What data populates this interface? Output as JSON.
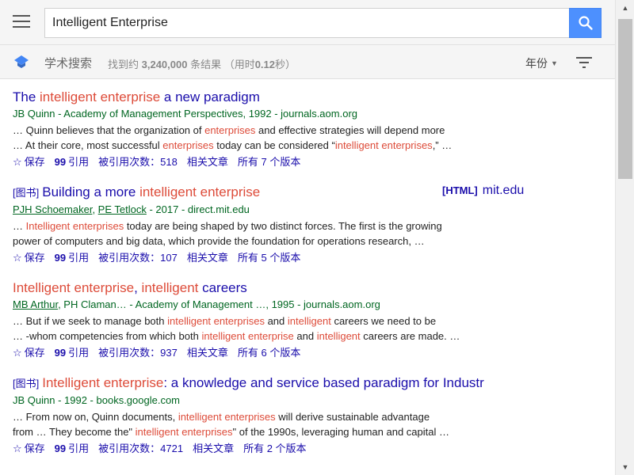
{
  "search": {
    "value": "Intelligent Enterprise"
  },
  "header": {
    "scholar_label": "学术搜索",
    "results_prefix": "找到约 ",
    "results_count": "3,240,000",
    "results_suffix": " 条结果 （用时",
    "time": "0.12",
    "time_suffix": "秒）",
    "year_label": "年份"
  },
  "results": [
    {
      "title_parts": [
        {
          "text": "The ",
          "hl": false
        },
        {
          "text": "intelligent enterprise",
          "hl": true
        },
        {
          "text": " a new paradigm",
          "hl": false
        }
      ],
      "tag": "",
      "authors_text": "JB Quinn - Academy of Management Perspectives, 1992 - journals.aom.org",
      "snippet_lines": [
        [
          {
            "text": "… Quinn believes that the organization of ",
            "hl": false
          },
          {
            "text": "enterprises",
            "hl": true
          },
          {
            "text": " and effective strategies will depend more",
            "hl": false
          }
        ],
        [
          {
            "text": "… At their core, most successful ",
            "hl": false
          },
          {
            "text": "enterprises",
            "hl": true
          },
          {
            "text": " today can be considered “",
            "hl": false
          },
          {
            "text": "intelligent enterprises",
            "hl": true
          },
          {
            "text": ",” …",
            "hl": false
          }
        ]
      ],
      "save": "保存",
      "cite": "引用",
      "cited_by": "被引用次数：518",
      "related": "相关文章",
      "versions": "所有 7 个版本"
    },
    {
      "tag": "[图书]",
      "title_parts": [
        {
          "text": "Building a more ",
          "hl": false
        },
        {
          "text": "intelligent enterprise",
          "hl": true
        }
      ],
      "side_tag": "[HTML]",
      "side_link": "mit.edu",
      "authors_links": [
        "PJH Schoemaker",
        "PE Tetlock"
      ],
      "authors_rest": " - 2017 - direct.mit.edu",
      "snippet_lines": [
        [
          {
            "text": "… ",
            "hl": false
          },
          {
            "text": "Intelligent enterprises",
            "hl": true
          },
          {
            "text": " today are being shaped by two distinct forces. The first is the growing",
            "hl": false
          }
        ],
        [
          {
            "text": "power of computers and big data, which provide the foundation for operations research, …",
            "hl": false
          }
        ]
      ],
      "save": "保存",
      "cite": "引用",
      "cited_by": "被引用次数：107",
      "related": "相关文章",
      "versions": "所有 5 个版本"
    },
    {
      "tag": "",
      "title_parts": [
        {
          "text": "Intelligent enterprise",
          "hl": true
        },
        {
          "text": ", ",
          "hl": false
        },
        {
          "text": "intelligent",
          "hl": true
        },
        {
          "text": " careers",
          "hl": false
        }
      ],
      "authors_links": [
        "MB Arthur"
      ],
      "authors_rest": ", PH Claman… - Academy of Management …, 1995 - journals.aom.org",
      "snippet_lines": [
        [
          {
            "text": "… But if we seek to manage both ",
            "hl": false
          },
          {
            "text": "intelligent enterprises",
            "hl": true
          },
          {
            "text": " and ",
            "hl": false
          },
          {
            "text": "intelligent",
            "hl": true
          },
          {
            "text": " careers we need to be",
            "hl": false
          }
        ],
        [
          {
            "text": "… -whom competencies from which both ",
            "hl": false
          },
          {
            "text": "intelligent enterprise",
            "hl": true
          },
          {
            "text": " and ",
            "hl": false
          },
          {
            "text": "intelligent",
            "hl": true
          },
          {
            "text": " careers are made. …",
            "hl": false
          }
        ]
      ],
      "save": "保存",
      "cite": "引用",
      "cited_by": "被引用次数：937",
      "related": "相关文章",
      "versions": "所有 6 个版本"
    },
    {
      "tag": "[图书]",
      "title_parts": [
        {
          "text": "Intelligent enterprise",
          "hl": true
        },
        {
          "text": ": a knowledge and service based paradigm for Industr",
          "hl": false
        }
      ],
      "authors_text": "JB Quinn - 1992 - books.google.com",
      "snippet_lines": [
        [
          {
            "text": "… From now on, Quinn documents, ",
            "hl": false
          },
          {
            "text": "intelligent enterprises",
            "hl": true
          },
          {
            "text": " will derive sustainable advantage",
            "hl": false
          }
        ],
        [
          {
            "text": "from … They become the\" ",
            "hl": false
          },
          {
            "text": "intelligent enterprises",
            "hl": true
          },
          {
            "text": "\" of the 1990s, leveraging human and capital …",
            "hl": false
          }
        ]
      ],
      "save": "保存",
      "cite": "引用",
      "cited_by": "被引用次数：4721",
      "related": "相关文章",
      "versions": "所有 2 个版本"
    }
  ],
  "colors": {
    "link": "#1a0dab",
    "highlight": "#dd4b39",
    "source": "#006621",
    "search_button": "#4d90fe"
  }
}
